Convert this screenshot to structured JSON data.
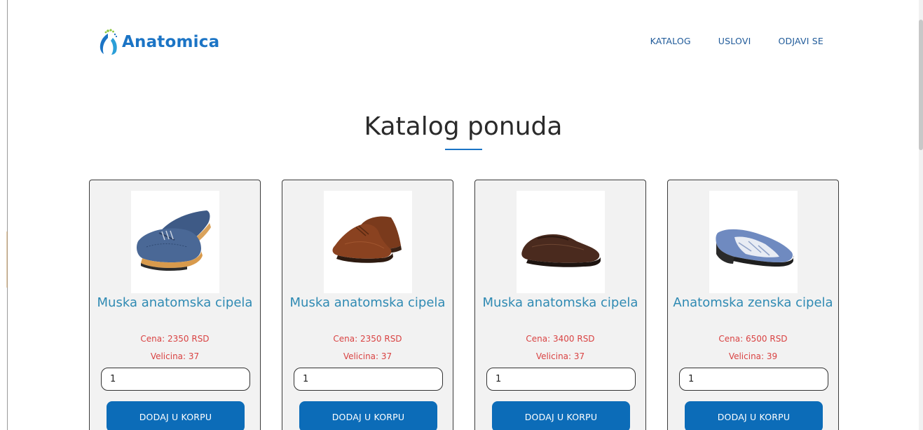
{
  "brand": {
    "name": "Anatomica",
    "color": "#1b74c5",
    "icon": "feet-logo-icon"
  },
  "nav": {
    "items": [
      {
        "label": "KATALOG"
      },
      {
        "label": "USLOVI"
      },
      {
        "label": "ODJAVI SE"
      }
    ]
  },
  "page": {
    "title": "Katalog ponuda"
  },
  "colors": {
    "accent": "#0c6cb8",
    "product_title": "#2f8ab3",
    "price": "#d94343",
    "card_background": "#f2f2f2"
  },
  "products": [
    {
      "image": "blue-brogue-shoe-image",
      "title": "Muska anatomska cipela",
      "price": "Cena: 2350 RSD",
      "size": "Velicina: 37",
      "quantity": "1",
      "button_label": "DODAJ U KORPU"
    },
    {
      "image": "brown-chukka-boot-image",
      "title": "Muska anatomska cipela",
      "price": "Cena: 2350 RSD",
      "size": "Velicina: 37",
      "quantity": "1",
      "button_label": "DODAJ U KORPU"
    },
    {
      "image": "brown-loafer-shoe-image",
      "title": "Muska anatomska cipela",
      "price": "Cena: 3400 RSD",
      "size": "Velicina: 37",
      "quantity": "1",
      "button_label": "DODAJ U KORPU"
    },
    {
      "image": "blue-womens-shoe-image",
      "title": "Anatomska zenska cipela",
      "price": "Cena: 6500 RSD",
      "size": "Velicina: 39",
      "quantity": "1",
      "button_label": "DODAJ U KORPU"
    }
  ]
}
